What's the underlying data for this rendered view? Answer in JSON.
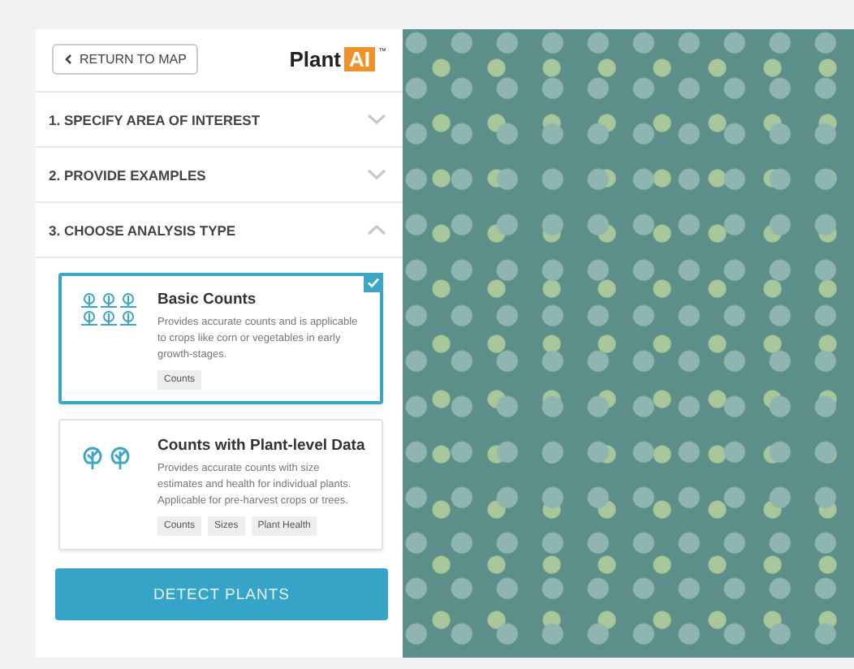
{
  "header": {
    "back_button": "RETURN TO MAP",
    "logo": {
      "word": "Plant",
      "badge": "AI",
      "mark": "™"
    }
  },
  "steps": [
    {
      "label": "1. SPECIFY AREA OF INTEREST",
      "expanded": false
    },
    {
      "label": "2. PROVIDE EXAMPLES",
      "expanded": false
    },
    {
      "label": "3. CHOOSE ANALYSIS TYPE",
      "expanded": true
    }
  ],
  "analysis_types": [
    {
      "kind": "small",
      "title": "Basic Counts",
      "description": "Provides accurate counts and is applicable to crops like corn or vegetables in early growth-stages.",
      "tags": [
        "Counts"
      ],
      "selected": true
    },
    {
      "kind": "tree",
      "title": "Counts with Plant-level Data",
      "description": "Provides accurate counts with size estimates and health for individual plants. Applicable for pre-harvest crops or trees.",
      "tags": [
        "Counts",
        "Sizes",
        "Plant Health"
      ],
      "selected": false
    }
  ],
  "action_button": "DETECT PLANTS"
}
